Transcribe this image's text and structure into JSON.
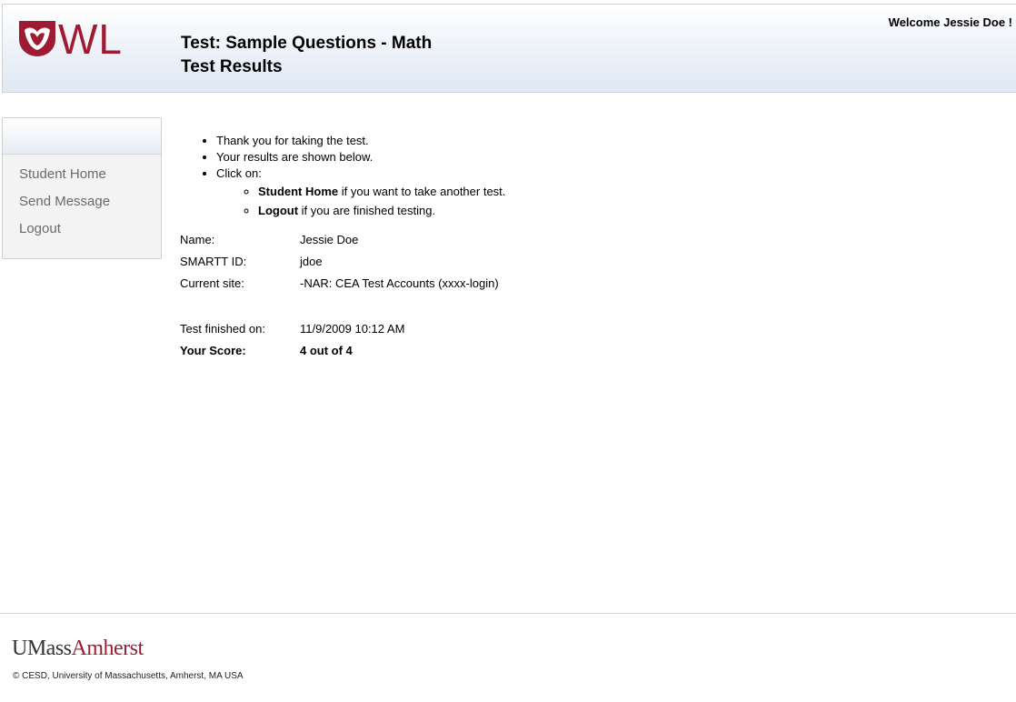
{
  "header": {
    "logo_text": "WL",
    "title_line1": "Test: Sample Questions - Math",
    "title_line2": "Test Results",
    "welcome": "Welcome Jessie Doe !"
  },
  "sidebar": {
    "items": [
      {
        "label": "Student Home"
      },
      {
        "label": "Send Message"
      },
      {
        "label": "Logout"
      }
    ]
  },
  "main": {
    "bullets": [
      "Thank you for taking the test.",
      "Your results are shown below.",
      "Click on:"
    ],
    "sub_items": [
      {
        "link": "Student Home",
        "text": " if you want to take another test."
      },
      {
        "link": "Logout",
        "text": " if you are finished testing."
      }
    ],
    "info": {
      "name_label": "Name:",
      "name_value": "Jessie Doe",
      "id_label": "SMARTT ID:",
      "id_value": "jdoe",
      "site_label": "Current site:",
      "site_value": "-NAR: CEA Test Accounts (xxxx-login)",
      "finished_label": "Test finished on:",
      "finished_value": "11/9/2009 10:12 AM",
      "score_label": "Your Score:",
      "score_value": "4 out of 4"
    }
  },
  "footer": {
    "logo_umass": "UMass",
    "logo_amherst": "Amherst",
    "copyright": "© CESD, University of Massachusetts, Amherst, MA USA"
  },
  "colors": {
    "brand": "#9e1b32",
    "nav_text": "#6a6a6a"
  }
}
